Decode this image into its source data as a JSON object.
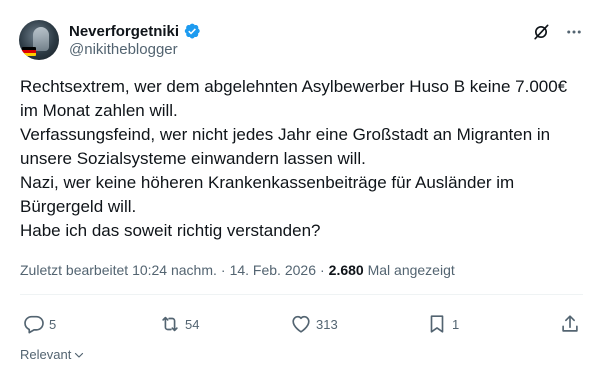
{
  "author": {
    "display_name": "Neverforgetniki",
    "handle": "@nikitheblogger",
    "verified": true,
    "avatar_icon": "avatar-photo-icon"
  },
  "tweet": {
    "lines": [
      "Rechtsextrem, wer dem abgelehnten Asylbewerber Huso B keine 7.000€",
      "im Monat zahlen will.",
      "Verfassungsfeind, wer nicht jedes Jahr eine Großstadt an Migranten in",
      "unsere Sozialsysteme einwandern lassen will.",
      "Nazi, wer keine höheren Krankenkassenbeiträge für Ausländer im",
      "Bürgergeld will.",
      "Habe ich das soweit richtig verstanden?"
    ]
  },
  "meta": {
    "edited_label": "Zuletzt bearbeitet",
    "time": "10:24 nachm.",
    "date": "14. Feb. 2026",
    "views_count": "2.680",
    "views_label": "Mal angezeigt"
  },
  "actions": {
    "replies": "5",
    "reposts": "54",
    "likes": "313",
    "bookmarks": "1"
  },
  "footer": {
    "sort_label": "Relevant"
  },
  "colors": {
    "text": "#0f1419",
    "secondary": "#536471",
    "verified": "#1d9bf0",
    "divider": "#eff3f4"
  }
}
